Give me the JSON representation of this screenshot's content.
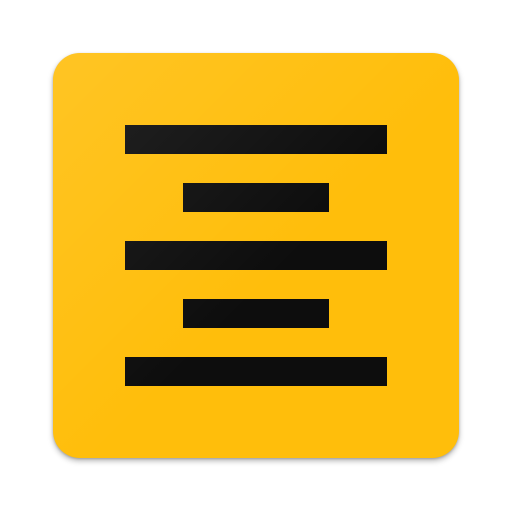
{
  "icon": {
    "name": "text-align-center-icon",
    "background_color": "#FFBE0B",
    "glyph_color": "#0D0D0D",
    "line_count": 5
  }
}
